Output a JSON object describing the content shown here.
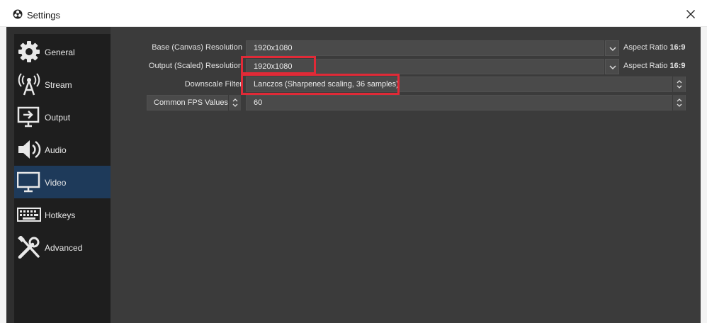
{
  "window": {
    "title": "Settings"
  },
  "sidebar": {
    "items": [
      {
        "label": "General",
        "icon": "gear-icon"
      },
      {
        "label": "Stream",
        "icon": "broadcast-tower-icon"
      },
      {
        "label": "Output",
        "icon": "monitor-output-icon"
      },
      {
        "label": "Audio",
        "icon": "speaker-icon"
      },
      {
        "label": "Video",
        "icon": "monitor-icon",
        "selected": true
      },
      {
        "label": "Hotkeys",
        "icon": "keyboard-icon"
      },
      {
        "label": "Advanced",
        "icon": "tools-icon"
      }
    ]
  },
  "video": {
    "base_resolution": {
      "label": "Base (Canvas) Resolution",
      "value": "1920x1080",
      "aspect_label": "Aspect Ratio",
      "aspect_value": "16:9"
    },
    "output_resolution": {
      "label": "Output (Scaled) Resolution",
      "value": "1920x1080",
      "aspect_label": "Aspect Ratio",
      "aspect_value": "16:9"
    },
    "downscale_filter": {
      "label": "Downscale Filter",
      "value": "Lanczos (Sharpened scaling, 36 samples)"
    },
    "fps": {
      "type_label": "Common FPS Values",
      "value": "60"
    }
  },
  "colors": {
    "highlight": "#e02a37",
    "selected_bg": "#1e3a5a",
    "content_bg": "#3b3b3b",
    "sidebar_bg": "#1e1e1e"
  }
}
